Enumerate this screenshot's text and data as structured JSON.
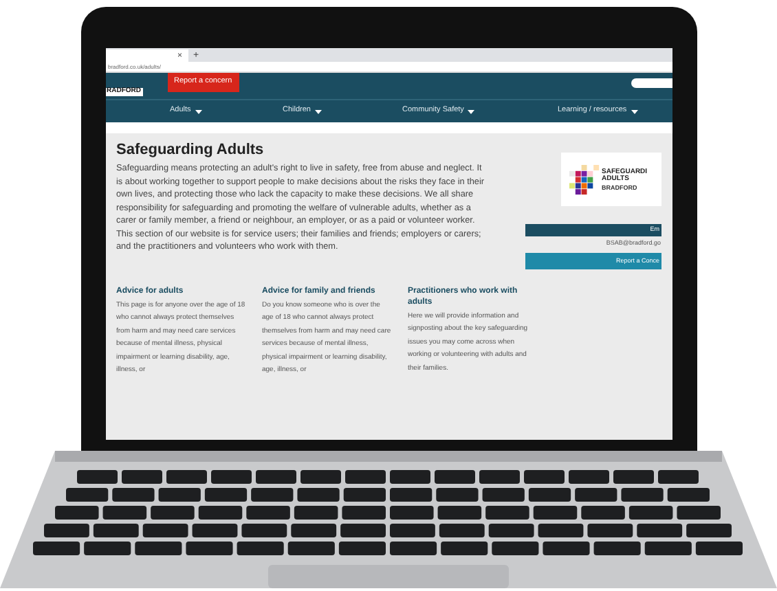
{
  "browser": {
    "tab_close": "×",
    "new_tab": "+",
    "url": "bradford.co.uk/adults/"
  },
  "header": {
    "logo_text": "RADFORD",
    "report_button": "Report a concern",
    "nav": [
      {
        "label": "Adults"
      },
      {
        "label": "Children"
      },
      {
        "label": "Community Safety"
      },
      {
        "label": "Learning / resources"
      }
    ]
  },
  "main": {
    "title": "Safeguarding Adults",
    "body": "Safeguarding means protecting an adult's right to live in safety, free from abuse and neglect. It is about working together to support people to make decisions about the risks they face in their own lives, and protecting those who lack the capacity to make these decisions. We all share responsibility for safeguarding and promoting the welfare of vulnerable adults, whether as a carer or family member, a friend or neighbour, an employer, or as a paid or volunteer worker. This section of our website is for service users; their families and friends; employers or carers; and the practitioners and volunteers who work with them."
  },
  "sidebar": {
    "logo_lines": [
      "SAFEGUARDI",
      "ADULTS",
      "BRADFORD"
    ],
    "email_button": "Em",
    "email": "BSAB@bradford.go",
    "report_button": "Report a Conce"
  },
  "cards": [
    {
      "title": "Advice for adults",
      "body": "This page is for anyone over the age of 18 who cannot always protect themselves from harm and may need care services because of mental illness, physical impairment or learning disability, age, illness, or"
    },
    {
      "title": "Advice for family and friends",
      "body": "Do you know someone who is over the age of 18 who cannot always protect themselves from harm and may need care services because of mental illness, physical impairment or learning disability, age, illness, or"
    },
    {
      "title": "Practitioners who work with adults",
      "body": "Here we will provide information and signposting about the key safeguarding issues you may come across when working or volunteering with adults and their families."
    }
  ]
}
